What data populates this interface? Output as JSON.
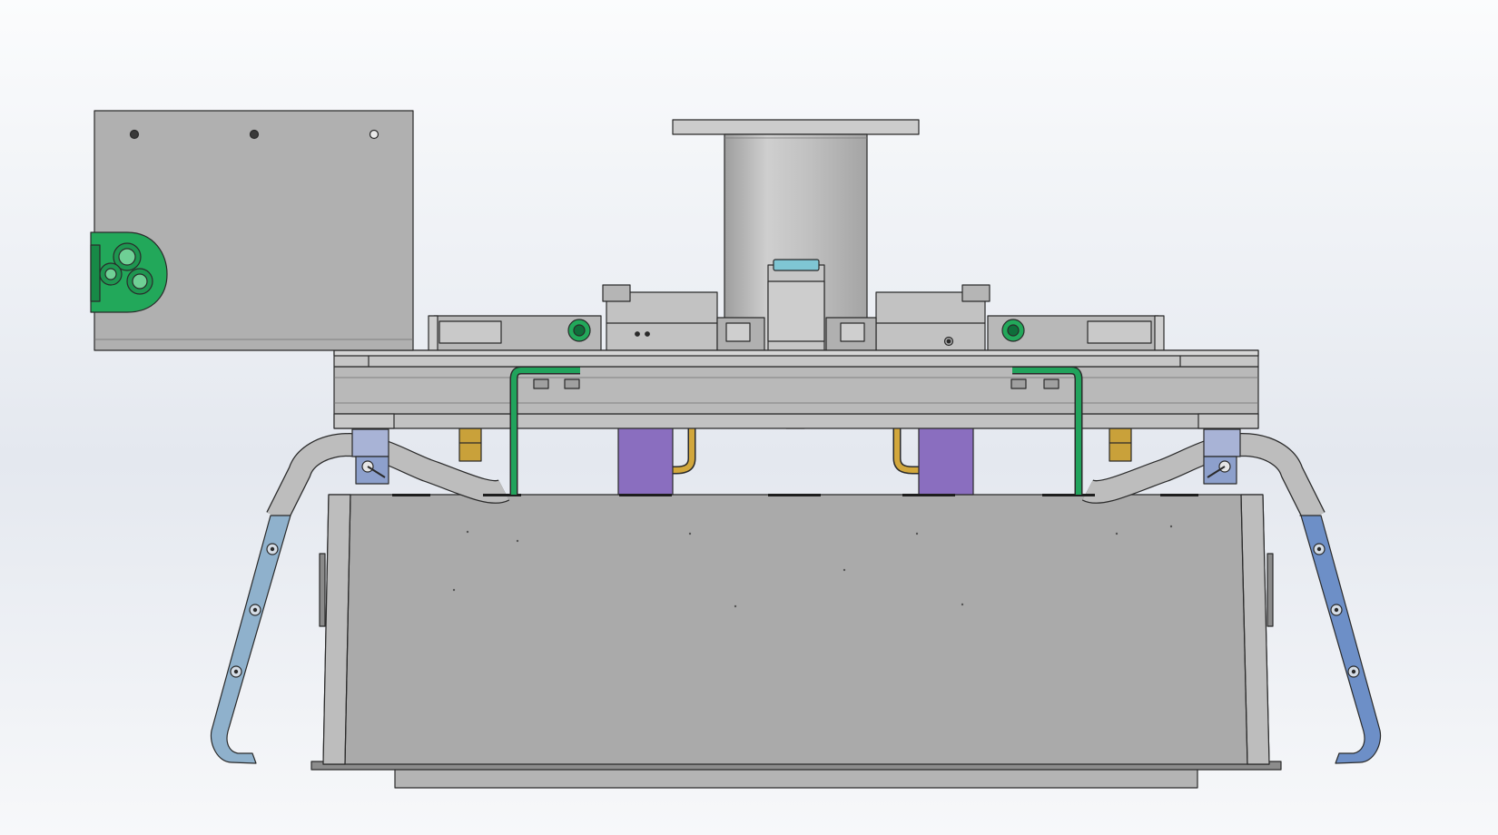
{
  "scene": {
    "type": "cad-viewport",
    "view": "front",
    "background": {
      "top": "#fbfcfd",
      "middle": "#e4e8ef",
      "bottom": "#f7f8fa"
    },
    "part_colors": {
      "sheet_metal": "#aaaaaa",
      "sheet_metal_light": "#c2c2c2",
      "outline": "#2a2a2a",
      "connector_green": "#22a85a",
      "bracket_green": "#21a35c",
      "purple_block": "#8a6ebf",
      "brass_fitting": "#c9a13a",
      "blue_clamp": "#8da0cc",
      "arm_blue_left": "#8fb1cc",
      "arm_blue_right": "#6d8fc7",
      "cyan_cap": "#7fc6d4"
    },
    "components": [
      "control-box",
      "circular-connector-plate",
      "top-cylinder",
      "valve-left",
      "valve-right",
      "mounting-plate",
      "main-hopper",
      "support-arm-left",
      "support-arm-right"
    ]
  }
}
